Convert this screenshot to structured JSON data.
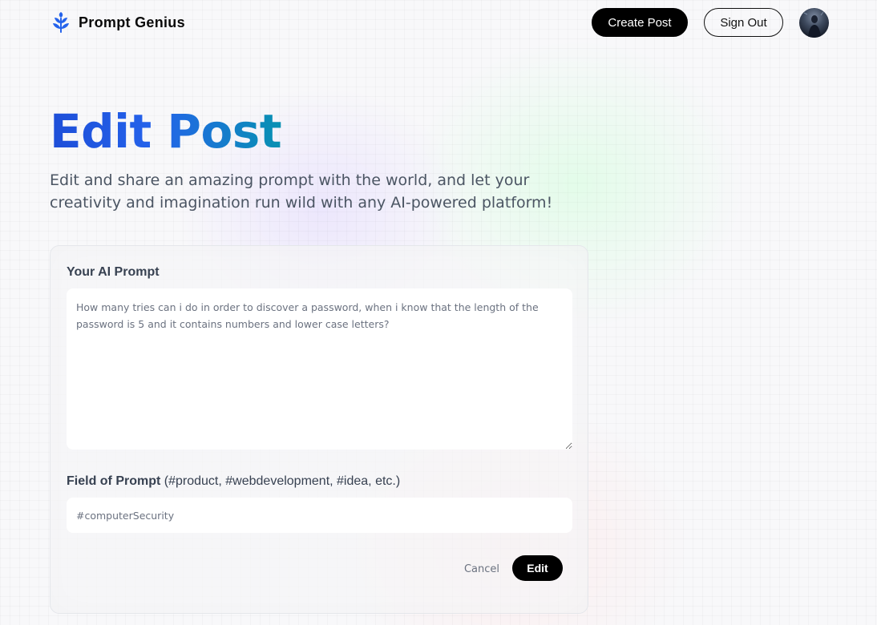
{
  "nav": {
    "brand_name": "Prompt Genius",
    "create_post_label": "Create Post",
    "sign_out_label": "Sign Out"
  },
  "hero": {
    "title": "Edit Post",
    "subtitle": "Edit and share an amazing prompt with the world, and let your creativity and imagination run wild with any AI-powered platform!"
  },
  "form": {
    "prompt_label": "Your AI Prompt",
    "prompt_value": "How many tries can i do in order to discover a password, when i know that the length of the password is 5 and it contains numbers and lower case letters?",
    "field_label": "Field of Prompt",
    "field_hint": "(#product, #webdevelopment, #idea, etc.)",
    "tag_value": "#computerSecurity",
    "cancel_label": "Cancel",
    "submit_label": "Edit"
  },
  "colors": {
    "title_gradient_start": "#1d4ed8",
    "title_gradient_end": "#0891b2",
    "primary_button": "#000000",
    "brand_icon": "#2563eb"
  },
  "icons": {
    "brand": "leaf-sprout-icon",
    "avatar": "user-avatar"
  }
}
